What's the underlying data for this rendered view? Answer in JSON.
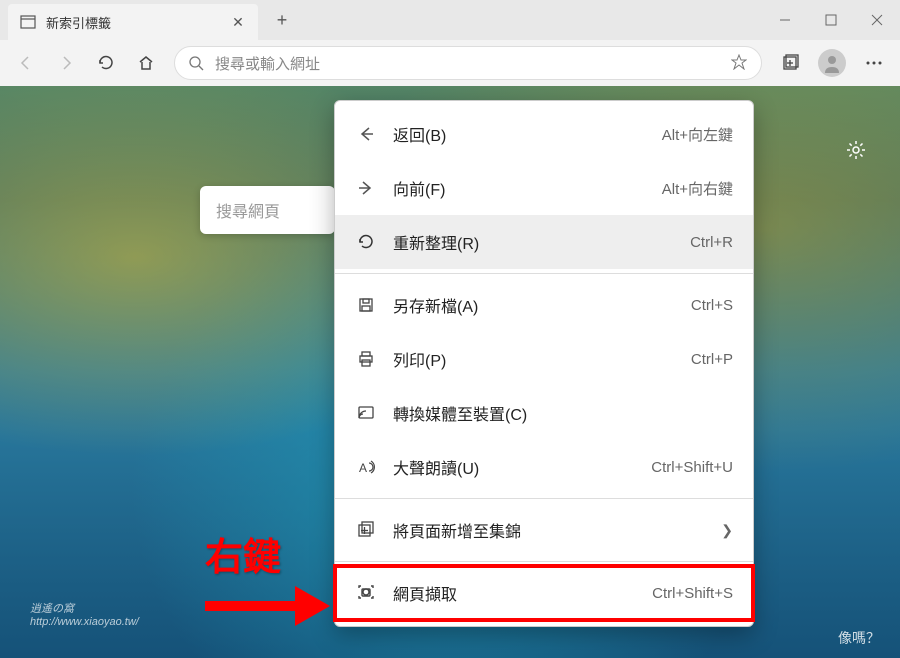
{
  "tab": {
    "title": "新索引標籤"
  },
  "addressbar": {
    "placeholder": "搜尋或輸入網址"
  },
  "searchbox": {
    "placeholder": "搜尋網頁"
  },
  "context_menu": {
    "back": {
      "label": "返回(B)",
      "shortcut": "Alt+向左鍵"
    },
    "forward": {
      "label": "向前(F)",
      "shortcut": "Alt+向右鍵"
    },
    "reload": {
      "label": "重新整理(R)",
      "shortcut": "Ctrl+R"
    },
    "save_as": {
      "label": "另存新檔(A)",
      "shortcut": "Ctrl+S"
    },
    "print": {
      "label": "列印(P)",
      "shortcut": "Ctrl+P"
    },
    "cast": {
      "label": "轉換媒體至裝置(C)",
      "shortcut": ""
    },
    "read_aloud": {
      "label": "大聲朗讀(U)",
      "shortcut": "Ctrl+Shift+U"
    },
    "collections": {
      "label": "將頁面新增至集錦",
      "shortcut": ""
    },
    "capture": {
      "label": "網頁擷取",
      "shortcut": "Ctrl+Shift+S"
    }
  },
  "annotation": {
    "label": "右鍵"
  },
  "watermark": {
    "text": "逍遙の窩",
    "url": "http://www.xiaoyao.tw/"
  },
  "bottom_text": "像嗎？"
}
